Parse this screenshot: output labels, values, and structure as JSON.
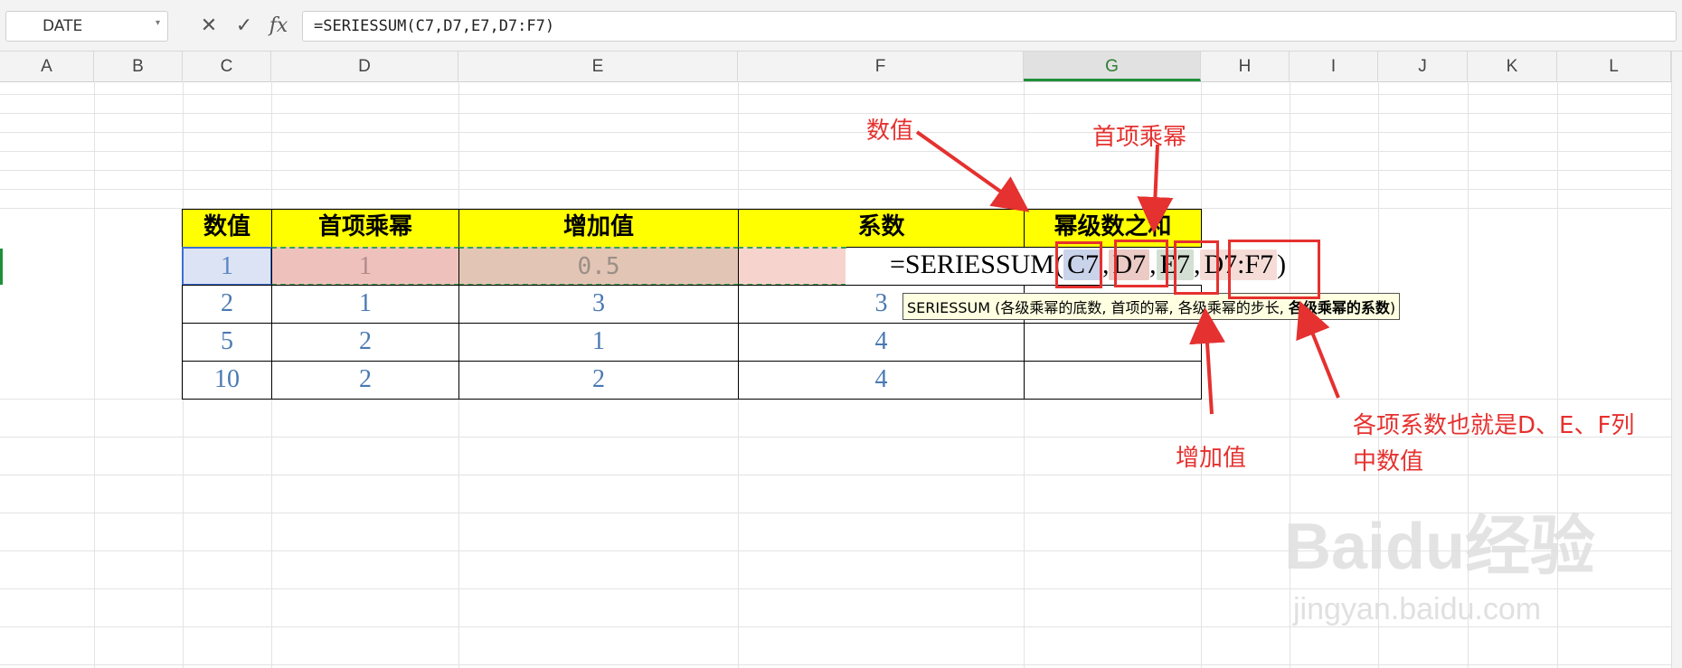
{
  "formula_bar": {
    "name_box": "DATE",
    "cancel_icon": "✕",
    "enter_icon": "✓",
    "fx_label": "fx",
    "formula": "=SERIESSUM(C7,D7,E7,D7:F7)"
  },
  "columns": [
    "A",
    "B",
    "C",
    "D",
    "E",
    "F",
    "G",
    "H",
    "I",
    "J",
    "K",
    "L"
  ],
  "table": {
    "headers": [
      "数值",
      "首项乘幂",
      "增加值",
      "系数",
      "幂级数之和"
    ],
    "rows": [
      [
        "1",
        "1",
        "0.5",
        ""
      ],
      [
        "2",
        "1",
        "3",
        "3"
      ],
      [
        "5",
        "2",
        "1",
        "4"
      ],
      [
        "10",
        "2",
        "2",
        "4"
      ]
    ]
  },
  "cell_formula": {
    "prefix": "=SERIESSUM(",
    "arg1": "C7",
    "sep1": ",",
    "arg2": "D7",
    "sep2": ",",
    "arg3": "E7",
    "sep3": ",",
    "arg4": "D7:F7",
    "suffix": ")"
  },
  "tooltip": {
    "text": "SERIESSUM (各级乘幂的底数, 首项的幂, 各级乘幂的步长, ",
    "bold": "各级乘幂的系数",
    "end": ")"
  },
  "annotations": {
    "value": "数值",
    "first_power": "首项乘幂",
    "increment": "增加值",
    "coefficients_line1": "各项系数也就是D、E、F列",
    "coefficients_line2": "中数值"
  },
  "watermark": {
    "logo": "Baidu经验",
    "url": "jingyan.baidu.com"
  },
  "colors": {
    "annotation_red": "#e5312f",
    "header_yellow": "#ffff00",
    "number_blue": "#4a79b3"
  }
}
